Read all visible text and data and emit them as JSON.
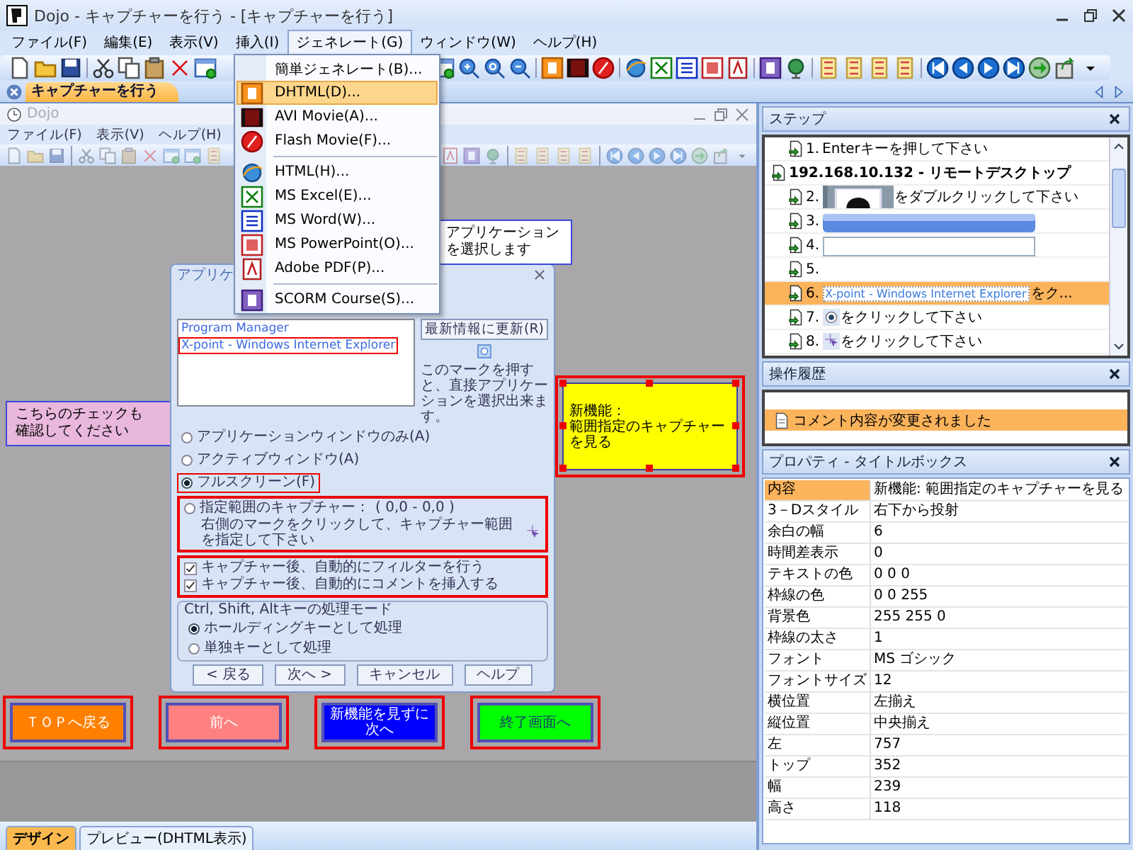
{
  "window": {
    "title": "Dojo - キャプチャーを行う - [キャプチャーを行う]"
  },
  "menu": [
    {
      "label": "ファイル(F)",
      "selected": false
    },
    {
      "label": "編集(E)",
      "selected": false
    },
    {
      "label": "表示(V)",
      "selected": false
    },
    {
      "label": "挿入(I)",
      "selected": false
    },
    {
      "label": "ジェネレート(G)",
      "selected": true
    },
    {
      "label": "ウィンドウ(W)",
      "selected": false
    },
    {
      "label": "ヘルプ(H)",
      "selected": false
    }
  ],
  "generate_menu": [
    {
      "label": "簡単ジェネレート(B)...",
      "kind": "none",
      "selected": false,
      "divider_before": false
    },
    {
      "label": "DHTML(D)...",
      "kind": "dhtml",
      "selected": true,
      "divider_before": false
    },
    {
      "label": "AVI Movie(A)...",
      "kind": "film",
      "selected": false,
      "divider_before": false
    },
    {
      "label": "Flash Movie(F)...",
      "kind": "flash",
      "selected": false,
      "divider_before": false
    },
    {
      "label": "HTML(H)...",
      "kind": "html",
      "selected": false,
      "divider_before": true
    },
    {
      "label": "MS Excel(E)...",
      "kind": "excel",
      "selected": false,
      "divider_before": false
    },
    {
      "label": "MS Word(W)...",
      "kind": "word",
      "selected": false,
      "divider_before": false
    },
    {
      "label": "MS PowerPoint(O)...",
      "kind": "ppt",
      "selected": false,
      "divider_before": false
    },
    {
      "label": "Adobe PDF(P)...",
      "kind": "pdf",
      "selected": false,
      "divider_before": false
    },
    {
      "label": "SCORM Course(S)...",
      "kind": "scorm",
      "selected": false,
      "divider_before": true
    }
  ],
  "doc_tabs": [
    {
      "label": "キャプチャーを行う",
      "selected": true
    }
  ],
  "inner_window": {
    "title": "Dojo",
    "menu": [
      "ファイル(F)",
      "表示(V)",
      "ヘルプ(H)"
    ]
  },
  "canvas": {
    "callouts": [
      {
        "kind": "note",
        "lines": [
          "アプリケーション",
          "を選択します"
        ]
      },
      {
        "kind": "pink",
        "lines": [
          "こちらのチェックも",
          "確認してください"
        ]
      }
    ],
    "dialog": {
      "title": "アプリケ",
      "list": [
        {
          "text": "Program Manager",
          "selected": false
        },
        {
          "text": "X-point - Windows Internet Explorer",
          "selected": true
        }
      ],
      "refresh_button": "最新情報に更新(R)",
      "note": "このマークを押すと、直接アプリケーションを選択出来ます。",
      "radios": [
        {
          "label": "アプリケーションウィンドウのみ(A)",
          "selected": false
        },
        {
          "label": "アクティブウィンドウ(A)",
          "selected": false
        },
        {
          "label": "フルスクリーン(F)",
          "selected": true
        }
      ],
      "range_capture": {
        "label": "指定範囲のキャプチャー：",
        "coords": "( 0,0 - 0,0 )",
        "selected": false,
        "hint": "右側のマークをクリックして、キャプチャー範囲を指定して下さい"
      },
      "checkboxes": [
        {
          "label": "キャプチャー後、自動的にフィルターを行う",
          "checked": true
        },
        {
          "label": "キャプチャー後、自動的にコメントを挿入する",
          "checked": true
        }
      ],
      "mode_group": {
        "title": "Ctrl, Shift, Altキーの処理モード",
        "options": [
          {
            "label": "ホールディングキーとして処理",
            "selected": true
          },
          {
            "label": "単独キーとして処理",
            "selected": false
          }
        ]
      },
      "buttons": [
        "< 戻る",
        "次へ >",
        "キャンセル",
        "ヘルプ"
      ]
    },
    "title_box": {
      "lines": [
        "新機能：",
        "範囲指定のキャプチャー",
        "を見る"
      ],
      "selected": true
    },
    "buttons": [
      {
        "lines": [
          "ＴＯＰへ戻る"
        ],
        "color": "#ff8000"
      },
      {
        "lines": [
          "前へ"
        ],
        "color": "#ff8080"
      },
      {
        "lines": [
          "新機能を見ずに",
          "次へ"
        ],
        "color": "#0000ff"
      },
      {
        "lines": [
          "終了画面へ"
        ],
        "color": "#00ff00"
      }
    ]
  },
  "bottom_tabs": [
    {
      "label": "デザイン",
      "selected": true
    },
    {
      "label": "プレビュー(DHTML表示)",
      "selected": false
    }
  ],
  "steps_panel": {
    "title": "ステップ",
    "items": [
      {
        "kind": "plain",
        "number": "1.",
        "text": "Enterキーを押して下さい",
        "selected": false
      },
      {
        "kind": "group",
        "text": "192.168.10.132 - リモートデスクトップ",
        "children": [
          {
            "kind": "picture",
            "number": "2.",
            "text": "をダブルクリックして下さい",
            "selected": false
          },
          {
            "kind": "bar",
            "number": "3.",
            "selected": false
          },
          {
            "kind": "blank",
            "number": "4.",
            "selected": false
          },
          {
            "kind": "plain",
            "number": "5.",
            "selected": false
          },
          {
            "kind": "label",
            "number": "6.",
            "label": "X-point - Windows Internet Explorer",
            "text": "をク...",
            "selected": true
          },
          {
            "kind": "radio",
            "number": "7.",
            "text": "をクリックして下さい",
            "selected": false
          },
          {
            "kind": "cursor",
            "number": "8.",
            "text": "をクリックして下さい",
            "selected": false
          }
        ]
      }
    ]
  },
  "history_panel": {
    "title": "操作履歴",
    "items": [
      {
        "text": "コメント内容が変更されました",
        "selected": true
      }
    ]
  },
  "properties_panel": {
    "title": "プロパティ - タイトルボックス",
    "rows": [
      {
        "name": "内容",
        "value": "新機能: 範囲指定のキャプチャーを見る",
        "selected": true
      },
      {
        "name": "3－Dスタイル",
        "value": "右下から投射",
        "selected": false
      },
      {
        "name": "余白の幅",
        "value": "6",
        "selected": false
      },
      {
        "name": "時間差表示",
        "value": "0",
        "selected": false
      },
      {
        "name": "テキストの色",
        "value": "0 0 0",
        "selected": false
      },
      {
        "name": "枠線の色",
        "value": "0 0 255",
        "selected": false
      },
      {
        "name": "背景色",
        "value": "255 255 0",
        "selected": false
      },
      {
        "name": "枠線の太さ",
        "value": "1",
        "selected": false
      },
      {
        "name": "フォント",
        "value": "MS ゴシック",
        "selected": false
      },
      {
        "name": "フォントサイズ",
        "value": "12",
        "selected": false
      },
      {
        "name": "横位置",
        "value": "左揃え",
        "selected": false
      },
      {
        "name": "縦位置",
        "value": "中央揃え",
        "selected": false
      },
      {
        "name": "左",
        "value": "757",
        "selected": false
      },
      {
        "name": "トップ",
        "value": "352",
        "selected": false
      },
      {
        "name": "幅",
        "value": "239",
        "selected": false
      },
      {
        "name": "高さ",
        "value": "118",
        "selected": false
      }
    ]
  }
}
